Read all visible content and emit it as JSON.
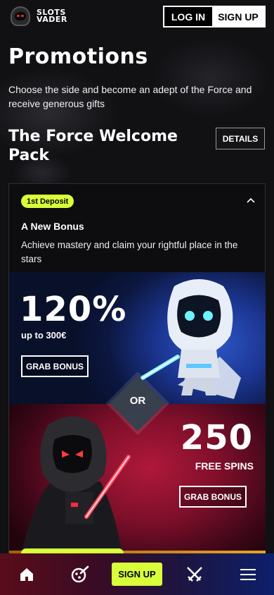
{
  "header": {
    "logo_line1": "SLOTS",
    "logo_line2": "VADER",
    "login_label": "LOG IN",
    "signup_label": "SIGN UP"
  },
  "page": {
    "title": "Promotions",
    "intro": "Choose the side and become an adept of the Force and receive generous gifts",
    "section_title": "The Force Welcome Pack",
    "details_label": "DETAILS"
  },
  "bonus": {
    "badge": "1st Deposit",
    "title": "A New Bonus",
    "description": "Achieve mastery and claim your rightful place in the stars",
    "offer1_amount": "120%",
    "offer1_sub": "up to 300€",
    "grab_label": "GRAB BONUS",
    "or_label": "OR",
    "offer2_amount": "250",
    "offer2_sub": "FREE SPINS"
  },
  "bottom_nav": {
    "signup_label": "SIGN UP",
    "icons": [
      "home-icon",
      "casino-icon",
      "swords-icon",
      "menu-icon"
    ]
  },
  "colors": {
    "accent": "#d9ff3a",
    "blue_panel": "#1b3590",
    "red_panel": "#7d0f2a"
  }
}
